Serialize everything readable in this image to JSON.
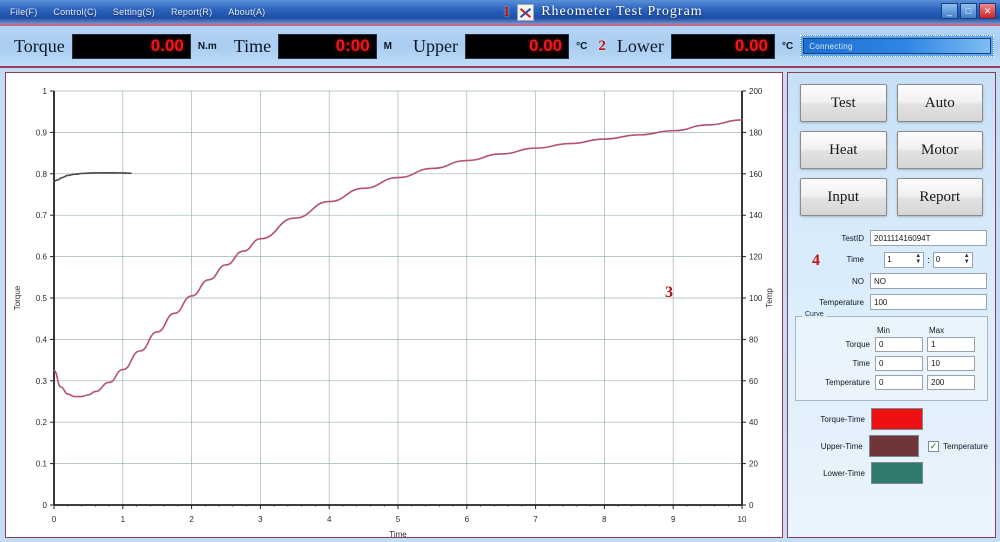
{
  "titlebar": {
    "menu": [
      {
        "label": "File(F)"
      },
      {
        "label": "Control(C)"
      },
      {
        "label": "Setting(S)"
      },
      {
        "label": "Report(R)"
      },
      {
        "label": "About(A)"
      }
    ],
    "annotation": "1",
    "app_title": "Rheometer Test Program",
    "icon": "app-icon",
    "window_buttons": [
      {
        "name": "minimize-button",
        "glyph": "_"
      },
      {
        "name": "maximize-button",
        "glyph": "□"
      },
      {
        "name": "close-button",
        "glyph": "✕"
      }
    ]
  },
  "readout": {
    "annotation": "2",
    "items": [
      {
        "label": "Torque",
        "value": "0.00",
        "unit": "N.m"
      },
      {
        "label": "Time",
        "value": "0:00",
        "unit": "M"
      },
      {
        "label": "Upper",
        "value": "0.00",
        "unit": "°C"
      },
      {
        "label": "Lower",
        "value": "0.00",
        "unit": "°C"
      }
    ],
    "status": "Connecting"
  },
  "buttons": [
    {
      "label": "Test"
    },
    {
      "label": "Auto"
    },
    {
      "label": "Heat"
    },
    {
      "label": "Motor"
    },
    {
      "label": "Input"
    },
    {
      "label": "Report"
    }
  ],
  "form": {
    "annotation": "4",
    "id_label": "TestID",
    "id_value": "201111416094T",
    "time_label": "Time",
    "time_hours": "1",
    "time_colon": ":",
    "time_minutes": "0",
    "no_label": "NO",
    "no_value": "NO",
    "temperature_label": "Temperature",
    "temperature_value": "100"
  },
  "curve_group": {
    "title": "Curve",
    "min_header": "Min",
    "max_header": "Max",
    "rows": [
      {
        "label": "Torque",
        "min": "0",
        "max": "1"
      },
      {
        "label": "Time",
        "min": "0",
        "max": "10"
      },
      {
        "label": "Temperature",
        "min": "0",
        "max": "200"
      }
    ]
  },
  "legend": {
    "rows": [
      {
        "label": "Torque-Time",
        "color": "#ee1111"
      },
      {
        "label": "Upper-Time",
        "color": "#6e3636"
      },
      {
        "label": "Lower-Time",
        "color": "#2e7b6e"
      }
    ],
    "checkbox_label": "Temperature",
    "checkbox_checked": "✓"
  },
  "chart_annotation": "3",
  "chart_data": {
    "type": "line",
    "title": "",
    "xlabel": "Time",
    "ylabel": "Torque",
    "y2label": "Temp",
    "xlim": [
      0,
      10
    ],
    "ylim": [
      0,
      1
    ],
    "y2lim": [
      0,
      200
    ],
    "xticks": [
      0,
      1,
      2,
      3,
      4,
      5,
      6,
      7,
      8,
      9,
      10
    ],
    "yticks": [
      0,
      0.1,
      0.2,
      0.3,
      0.4,
      0.5,
      0.6,
      0.7,
      0.8,
      0.9,
      1
    ],
    "y2ticks": [
      0,
      20,
      40,
      60,
      80,
      100,
      120,
      140,
      160,
      180,
      200
    ],
    "grid": true,
    "legend_position": "none",
    "series": [
      {
        "name": "Torque-Time",
        "color": "#b5536b",
        "axis": "left",
        "x": [
          0,
          0.1,
          0.2,
          0.3,
          0.4,
          0.5,
          0.6,
          0.8,
          1.0,
          1.25,
          1.5,
          1.75,
          2.0,
          2.25,
          2.5,
          2.75,
          3.0,
          3.5,
          4.0,
          4.5,
          5.0,
          5.5,
          6.0,
          6.5,
          7.0,
          7.5,
          8.0,
          8.5,
          9.0,
          9.5,
          10.0
        ],
        "y": [
          0.325,
          0.285,
          0.268,
          0.262,
          0.262,
          0.266,
          0.274,
          0.296,
          0.327,
          0.372,
          0.418,
          0.463,
          0.505,
          0.544,
          0.58,
          0.613,
          0.643,
          0.693,
          0.733,
          0.765,
          0.791,
          0.813,
          0.832,
          0.848,
          0.862,
          0.873,
          0.884,
          0.894,
          0.904,
          0.918,
          0.93
        ]
      },
      {
        "name": "Upper-Time",
        "color": "#4a4a4a",
        "axis": "right",
        "x": [
          0,
          0.05,
          0.12,
          0.2,
          0.3,
          0.42,
          0.55,
          0.7,
          0.85,
          1.0,
          1.12
        ],
        "y": [
          156.5,
          157.0,
          158.2,
          159.2,
          159.8,
          160.2,
          160.4,
          160.5,
          160.5,
          160.4,
          160.3
        ]
      }
    ]
  }
}
